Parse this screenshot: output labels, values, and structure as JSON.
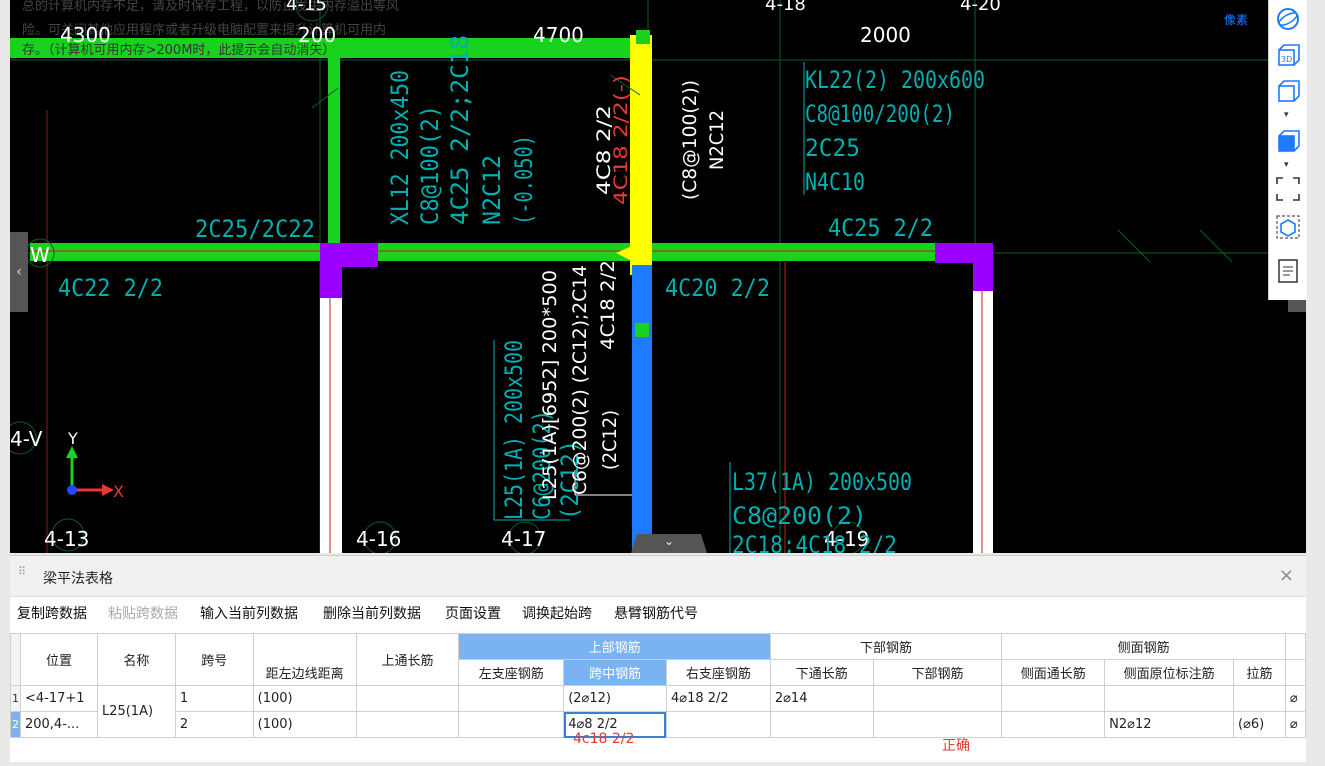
{
  "canvas": {
    "warning_lines": [
      "总的计算机内存不足，请及时保存工程，以防止发生内存溢出等风",
      "险。可关闭其他应用程序或者升级电脑配置来提升计算机可用内",
      "存。（计算机可用内存>200M时，此提示会自动消失）"
    ],
    "grid_labels": [
      "4-15",
      "4-18",
      "4-20",
      "W",
      "4-V",
      "4-13",
      "4-16",
      "4-17",
      "4-19"
    ],
    "dims": [
      "4300",
      "200",
      "4700",
      "2000"
    ],
    "annotations": {
      "kl22": [
        "KL22(2) 200x600",
        "C8@100/200(2)",
        "2C25",
        "N4C10"
      ],
      "xl12": [
        "XL12 200x450",
        "C8@100(2)",
        "4C25 2/2;2C18"
      ],
      "n2c12_left": [
        "N2C12",
        "(-0.050)"
      ],
      "top_left_beam": "2C25/2C22",
      "right_beam": "4C25 2/2",
      "lower_left": "4C22 2/2",
      "lower_mid": "4C20 2/2",
      "yellow_beam": [
        "4C8 2/2",
        "4C18 2/2(-)"
      ],
      "yellow_beam_right": [
        "(C8@100(2))",
        "N2C12"
      ],
      "l25": [
        "L25(1A)[6952] 200*500",
        "C6@200(2) (2C12);2C14",
        "(2C12)"
      ],
      "l25_vertical_blue": "4C18 2/2",
      "l25_cyan": [
        "L25(1A) 200x500",
        "C6@200(2)",
        "(2C12)"
      ],
      "l37": [
        "L37(1A) 200x500",
        "C8@200(2)",
        "2C18;4C18 2/2"
      ]
    },
    "axis": {
      "x": "X",
      "y": "Y"
    },
    "corner_label": "像素",
    "colors": {
      "background": "#000000",
      "green": "#19d21e",
      "yellow": "#ffff00",
      "blue": "#1e7bff",
      "purple": "#9b00ff",
      "cyan": "#00a3a3",
      "red": "#e53935",
      "white": "#ffffff"
    }
  },
  "toolbar_right": {
    "icons": [
      "sphere-icon",
      "3d-cube-icon",
      "cube-outline-icon",
      "cube-solid-icon",
      "fit-view-icon",
      "box-select-icon",
      "document-icon"
    ],
    "labels": {
      "three_d": "3D"
    }
  },
  "panel": {
    "title": "梁平法表格",
    "close": "×",
    "actions": [
      {
        "label": "复制跨数据",
        "enabled": true
      },
      {
        "label": "粘贴跨数据",
        "enabled": false
      },
      {
        "label": "输入当前列数据",
        "enabled": true
      },
      {
        "label": "删除当前列数据",
        "enabled": true
      },
      {
        "label": "页面设置",
        "enabled": true
      },
      {
        "label": "调换起始跨",
        "enabled": true
      },
      {
        "label": "悬臂钢筋代号",
        "enabled": true
      }
    ],
    "headers": {
      "position": "位置",
      "name": "名称",
      "span": "跨号",
      "dist_left": "距左边线距离",
      "top_through": "上通长筋",
      "top_group": "上部钢筋",
      "left_support": "左支座钢筋",
      "mid_span": "跨中钢筋",
      "right_support": "右支座钢筋",
      "bottom_group": "下部钢筋",
      "bottom_through": "下通长筋",
      "bottom_bars": "下部钢筋",
      "side_group": "侧面钢筋",
      "side_through": "侧面通长筋",
      "side_local": "侧面原位标注筋",
      "tie": "拉筋"
    },
    "rows": [
      {
        "no": "1",
        "position": "<4-17+1",
        "name": "L25(1A)",
        "span": "1",
        "dist_left": "(100)",
        "top_through": "",
        "left_support": "",
        "mid_span": "(2⌀12)",
        "right_support": "4⌀18 2/2",
        "bottom_through": "2⌀14",
        "bottom_bars": "",
        "side_through": "",
        "side_local": "",
        "tie": "",
        "extra": "⌀"
      },
      {
        "no": "2",
        "position": "200,4-...",
        "name": "",
        "span": "2",
        "dist_left": "(100)",
        "top_through": "",
        "left_support": "",
        "mid_span": "4⌀8 2/2",
        "right_support": "",
        "bottom_through": "",
        "bottom_bars": "",
        "side_through": "",
        "side_local": "N2⌀12",
        "tie": "(⌀6)",
        "extra": "⌀"
      }
    ],
    "notes": {
      "mid_span_note": "4c18  2/2",
      "right_note": "正确"
    }
  }
}
